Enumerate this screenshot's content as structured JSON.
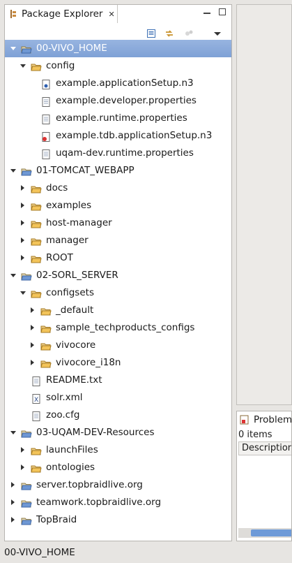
{
  "package_explorer": {
    "title": "Package Explorer",
    "close_glyph": "✕",
    "tree": [
      {
        "label": "00-VIVO_HOME",
        "level": 0,
        "type": "project",
        "toggle": "open",
        "selected": true
      },
      {
        "label": "config",
        "level": 1,
        "type": "folder",
        "toggle": "open"
      },
      {
        "label": "example.applicationSetup.n3",
        "level": 2,
        "type": "n3-file",
        "toggle": "none"
      },
      {
        "label": "example.developer.properties",
        "level": 2,
        "type": "properties-file",
        "toggle": "none"
      },
      {
        "label": "example.runtime.properties",
        "level": 2,
        "type": "properties-file",
        "toggle": "none"
      },
      {
        "label": "example.tdb.applicationSetup.n3",
        "level": 2,
        "type": "n3-red-file",
        "toggle": "none"
      },
      {
        "label": "uqam-dev.runtime.properties",
        "level": 2,
        "type": "properties-file",
        "toggle": "none"
      },
      {
        "label": "01-TOMCAT_WEBAPP",
        "level": 0,
        "type": "project",
        "toggle": "open"
      },
      {
        "label": "docs",
        "level": 1,
        "type": "folder",
        "toggle": "closed"
      },
      {
        "label": "examples",
        "level": 1,
        "type": "folder",
        "toggle": "closed"
      },
      {
        "label": "host-manager",
        "level": 1,
        "type": "folder",
        "toggle": "closed"
      },
      {
        "label": "manager",
        "level": 1,
        "type": "folder",
        "toggle": "closed"
      },
      {
        "label": "ROOT",
        "level": 1,
        "type": "folder",
        "toggle": "closed"
      },
      {
        "label": "02-SORL_SERVER",
        "level": 0,
        "type": "project",
        "toggle": "open"
      },
      {
        "label": "configsets",
        "level": 1,
        "type": "folder",
        "toggle": "open"
      },
      {
        "label": "_default",
        "level": 2,
        "type": "folder",
        "toggle": "closed"
      },
      {
        "label": "sample_techproducts_configs",
        "level": 2,
        "type": "folder",
        "toggle": "closed"
      },
      {
        "label": "vivocore",
        "level": 2,
        "type": "folder",
        "toggle": "closed"
      },
      {
        "label": "vivocore_i18n",
        "level": 2,
        "type": "folder",
        "toggle": "closed"
      },
      {
        "label": "README.txt",
        "level": 1,
        "type": "text-file",
        "toggle": "none"
      },
      {
        "label": "solr.xml",
        "level": 1,
        "type": "xml-file",
        "toggle": "none"
      },
      {
        "label": "zoo.cfg",
        "level": 1,
        "type": "cfg-file",
        "toggle": "none"
      },
      {
        "label": "03-UQAM-DEV-Resources",
        "level": 0,
        "type": "project",
        "toggle": "open"
      },
      {
        "label": "launchFiles",
        "level": 1,
        "type": "folder",
        "toggle": "closed"
      },
      {
        "label": "ontologies",
        "level": 1,
        "type": "folder",
        "toggle": "closed"
      },
      {
        "label": "server.topbraidlive.org",
        "level": 0,
        "type": "project",
        "toggle": "closed"
      },
      {
        "label": "teamwork.topbraidlive.org",
        "level": 0,
        "type": "project",
        "toggle": "closed"
      },
      {
        "label": "TopBraid",
        "level": 0,
        "type": "project",
        "toggle": "closed"
      }
    ]
  },
  "problems": {
    "title": "Problem",
    "count": "0 items",
    "column": "Description"
  },
  "status_bar": {
    "text": "00-VIVO_HOME"
  },
  "colors": {
    "selection": "#7fa1d6",
    "folder": "#e9b54a"
  }
}
